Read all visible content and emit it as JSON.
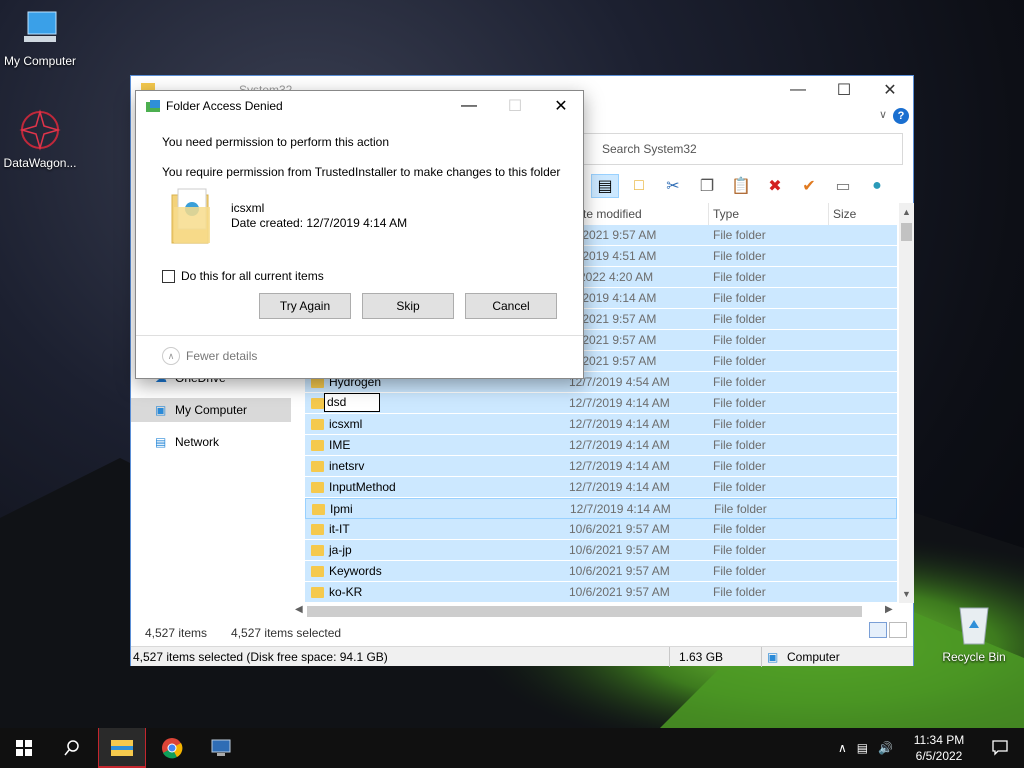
{
  "desktop": {
    "icons": [
      {
        "label": "My Computer"
      },
      {
        "label": "DataWagon..."
      },
      {
        "label": "Recycle Bin"
      }
    ]
  },
  "explorer": {
    "title": "System32",
    "search_placeholder": "Search System32",
    "columns": {
      "date": "te modified",
      "type": "Type",
      "size": "Size"
    },
    "rows": [
      {
        "name": "",
        "date": "/6/2021 9:57 AM",
        "type": "File folder"
      },
      {
        "name": "",
        "date": "/7/2019 4:51 AM",
        "type": "File folder"
      },
      {
        "name": "",
        "date": "3/2022 4:20 AM",
        "type": "File folder"
      },
      {
        "name": "",
        "date": "/7/2019 4:14 AM",
        "type": "File folder"
      },
      {
        "name": "",
        "date": "/6/2021 9:57 AM",
        "type": "File folder"
      },
      {
        "name": "",
        "date": "/6/2021 9:57 AM",
        "type": "File folder"
      },
      {
        "name": "",
        "date": "/6/2021 9:57 AM",
        "type": "File folder"
      },
      {
        "name": "Hydrogen",
        "date": "12/7/2019 4:54 AM",
        "type": "File folder"
      },
      {
        "name": "dsd",
        "date": "12/7/2019 4:14 AM",
        "type": "File folder"
      },
      {
        "name": "icsxml",
        "date": "12/7/2019 4:14 AM",
        "type": "File folder"
      },
      {
        "name": "IME",
        "date": "12/7/2019 4:14 AM",
        "type": "File folder"
      },
      {
        "name": "inetsrv",
        "date": "12/7/2019 4:14 AM",
        "type": "File folder"
      },
      {
        "name": "InputMethod",
        "date": "12/7/2019 4:14 AM",
        "type": "File folder"
      },
      {
        "name": "Ipmi",
        "date": "12/7/2019 4:14 AM",
        "type": "File folder"
      },
      {
        "name": "it-IT",
        "date": "10/6/2021 9:57 AM",
        "type": "File folder"
      },
      {
        "name": "ja-jp",
        "date": "10/6/2021 9:57 AM",
        "type": "File folder"
      },
      {
        "name": "Keywords",
        "date": "10/6/2021 9:57 AM",
        "type": "File folder"
      },
      {
        "name": "ko-KR",
        "date": "10/6/2021 9:57 AM",
        "type": "File folder"
      }
    ],
    "nav": {
      "onedrive": "OneDrive",
      "mycomputer": "My Computer",
      "network": "Network"
    },
    "status_items": "4,527 items",
    "status_selected": "4,527 items selected",
    "statusbar": {
      "left": "4,527 items selected (Disk free space: 94.1 GB)",
      "size": "1.63 GB",
      "location": "Computer"
    }
  },
  "dialog": {
    "title": "Folder Access Denied",
    "line1": "You need permission to perform this action",
    "line2": "You require permission from TrustedInstaller to make changes to this folder",
    "file_name": "icsxml",
    "file_date": "Date created: 12/7/2019 4:14 AM",
    "checkbox_label": "Do this for all current items",
    "buttons": {
      "try_again": "Try Again",
      "skip": "Skip",
      "cancel": "Cancel"
    },
    "fewer_details": "Fewer details"
  },
  "taskbar": {
    "time": "11:34 PM",
    "date": "6/5/2022"
  },
  "colors": {
    "selection": "#cce8ff",
    "accent": "#1a6fd0",
    "taskbar": "#101010"
  }
}
